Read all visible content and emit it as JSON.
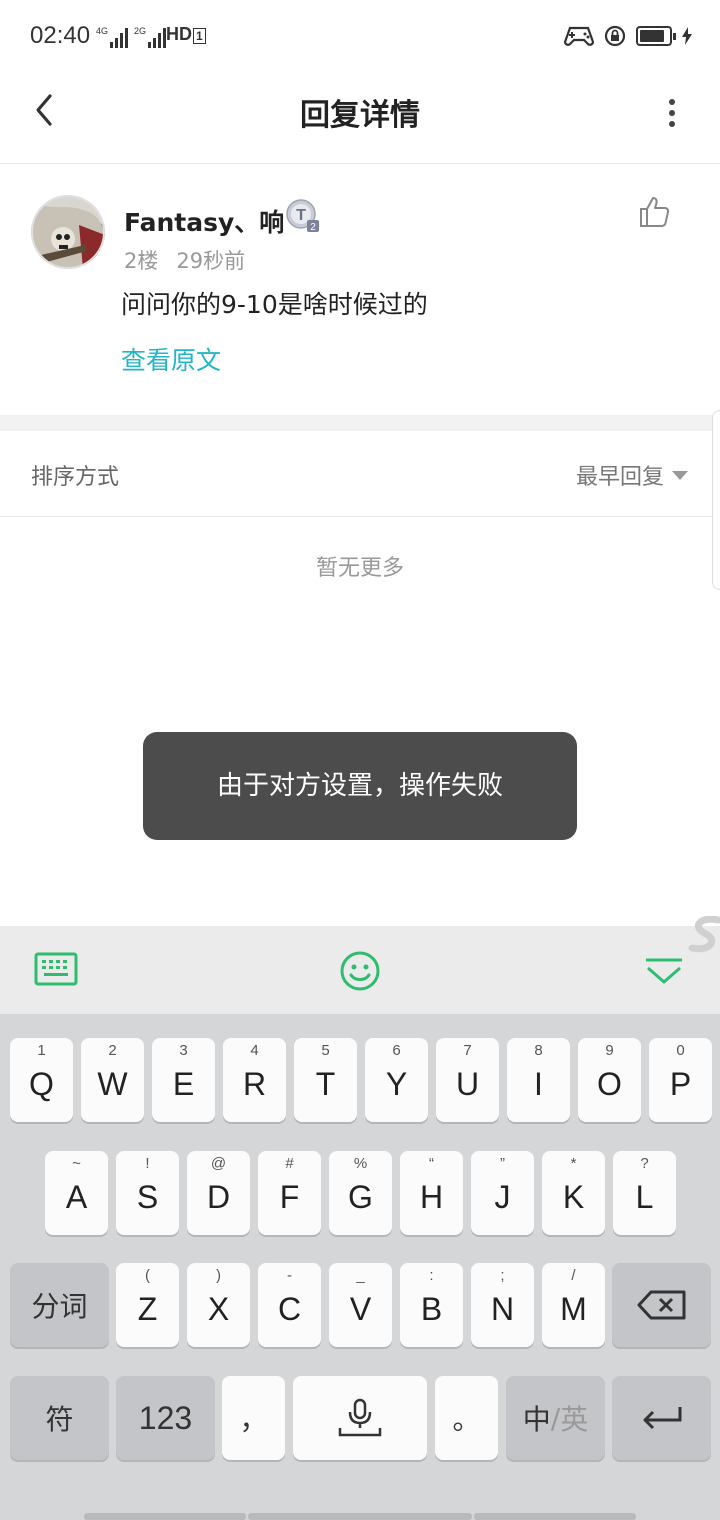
{
  "status_bar": {
    "time": "02:40",
    "net1": "4G",
    "net2": "2G",
    "hd": "HD",
    "hd_sub": "1"
  },
  "header": {
    "title": "回复详情"
  },
  "reply": {
    "username": "Fantasy、响",
    "badge_letter": "T",
    "badge_level": "2",
    "floor": "2楼",
    "time_ago": "29秒前",
    "content": "问问你的9-10是啥时候过的",
    "view_original": "查看原文"
  },
  "sort": {
    "label": "排序方式",
    "value": "最早回复"
  },
  "empty_text": "暂无更多",
  "toast": "由于对方设置，操作失败",
  "colors": {
    "link": "#23b6c4",
    "keyboard_accent": "#2ebd6e",
    "toast_bg": "#4c4c4c"
  },
  "keyboard": {
    "row1": [
      {
        "hint": "1",
        "key": "Q"
      },
      {
        "hint": "2",
        "key": "W"
      },
      {
        "hint": "3",
        "key": "E"
      },
      {
        "hint": "4",
        "key": "R"
      },
      {
        "hint": "5",
        "key": "T"
      },
      {
        "hint": "6",
        "key": "Y"
      },
      {
        "hint": "7",
        "key": "U"
      },
      {
        "hint": "8",
        "key": "I"
      },
      {
        "hint": "9",
        "key": "O"
      },
      {
        "hint": "0",
        "key": "P"
      }
    ],
    "row2": [
      {
        "hint": "~",
        "key": "A"
      },
      {
        "hint": "!",
        "key": "S"
      },
      {
        "hint": "@",
        "key": "D"
      },
      {
        "hint": "#",
        "key": "F"
      },
      {
        "hint": "%",
        "key": "G"
      },
      {
        "hint": "“",
        "key": "H"
      },
      {
        "hint": "”",
        "key": "J"
      },
      {
        "hint": "*",
        "key": "K"
      },
      {
        "hint": "?",
        "key": "L"
      }
    ],
    "row3": [
      {
        "hint": "(",
        "key": "Z"
      },
      {
        "hint": ")",
        "key": "X"
      },
      {
        "hint": "-",
        "key": "C"
      },
      {
        "hint": "_",
        "key": "V"
      },
      {
        "hint": ":",
        "key": "B"
      },
      {
        "hint": ";",
        "key": "N"
      },
      {
        "hint": "/",
        "key": "M"
      }
    ],
    "segment_label": "分词",
    "symbols_label": "符",
    "numbers_label": "123",
    "comma_label": "，",
    "period_label": "。",
    "lang_primary": "中",
    "lang_sep": "/",
    "lang_secondary": "英"
  }
}
